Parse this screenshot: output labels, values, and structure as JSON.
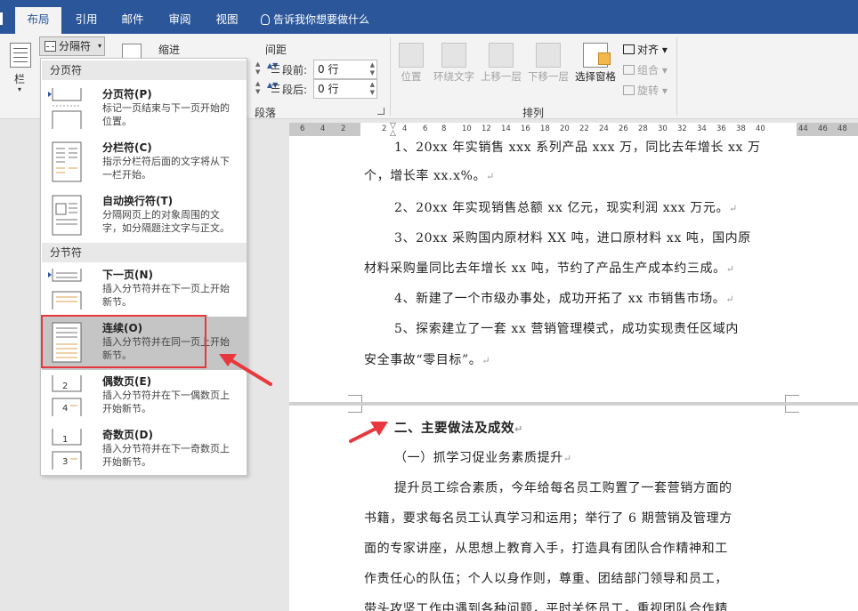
{
  "tabs": {
    "layout": "布局",
    "references": "引用",
    "mailings": "邮件",
    "review": "审阅",
    "view": "视图"
  },
  "tell_me": "告诉我你想要做什么",
  "ribbon": {
    "columns_fragment": "栏",
    "breaks_button": "分隔符",
    "indent_label": "缩进",
    "spacing_label": "间距",
    "spacing_before_label": "段前:",
    "spacing_before_value": "0 行",
    "spacing_after_label": "段后:",
    "spacing_after_value": "0 行",
    "paragraph_group": "段落",
    "arrange_group": "排列",
    "position": "位置",
    "wrap_text": "环绕文字",
    "bring_forward": "上移一层",
    "send_backward": "下移一层",
    "selection_pane": "选择窗格",
    "align": "对齐",
    "group": "组合",
    "rotate": "旋转"
  },
  "ruler_ticks": [
    "6",
    "4",
    "2",
    "2",
    "4",
    "6",
    "8",
    "10",
    "12",
    "14",
    "16",
    "18",
    "20",
    "22",
    "24",
    "26",
    "28",
    "30",
    "32",
    "34",
    "36",
    "38",
    "40",
    "44",
    "46",
    "48"
  ],
  "breaks_menu": {
    "page_breaks_header": "分页符",
    "section_breaks_header": "分节符",
    "items": [
      {
        "title": "分页符(P)",
        "desc": "标记一页结束与下一页开始的\n位置。"
      },
      {
        "title": "分栏符(C)",
        "desc": "指示分栏符后面的文字将从下\n一栏开始。"
      },
      {
        "title": "自动换行符(T)",
        "desc": "分隔网页上的对象周围的文\n字，如分隔题注文字与正文。"
      },
      {
        "title": "下一页(N)",
        "desc": "插入分节符并在下一页上开始\n新节。"
      },
      {
        "title": "连续(O)",
        "desc": "插入分节符并在同一页上开始\n新节。"
      },
      {
        "title": "偶数页(E)",
        "desc": "插入分节符并在下一偶数页上\n开始新节。"
      },
      {
        "title": "奇数页(D)",
        "desc": "插入分节符并在下一奇数页上\n开始新节。"
      }
    ]
  },
  "document": {
    "page1_lines": [
      "1、20xx 年实销售 xxx 系列产品 xxx 万，同比去年增长 xx 万",
      "个，增长率 xx.x%。",
      "2、20xx 年实现销售总额 xx 亿元，现实利润 xxx 万元。",
      "3、20xx 采购国内原材料 XX 吨，进口原材料 xx 吨，国内原",
      "材料采购量同比去年增长 xx 吨，节约了产品生产成本约三成。",
      "4、新建了一个市级办事处，成功开拓了 xx 市销售市场。",
      "5、探索建立了一套 xx 营销管理模式，成功实现责任区域内",
      "安全事故“零目标”。"
    ],
    "page2_heading": "二、主要做法及成效",
    "page2_subheading": "（一）抓学习促业务素质提升",
    "page2_lines": [
      "提升员工综合素质，今年给每名员工购置了一套营销方面的",
      "书籍，要求每名员工认真学习和运用；举行了 6 期营销及管理方",
      "面的专家讲座，从思想上教育入手，打造具有团队合作精神和工",
      "作责任心的队伍；个人以身作则，尊重、团结部门领导和员工，",
      "带头攻坚工作中遇到各种问题，平时关怀员工，重视团队合作精"
    ]
  },
  "colors": {
    "title_bar": "#2b579a",
    "ribbon_bg": "#f3f3f3",
    "highlight_item": "#c5c5c5",
    "annotation_red": "#e8383d"
  }
}
